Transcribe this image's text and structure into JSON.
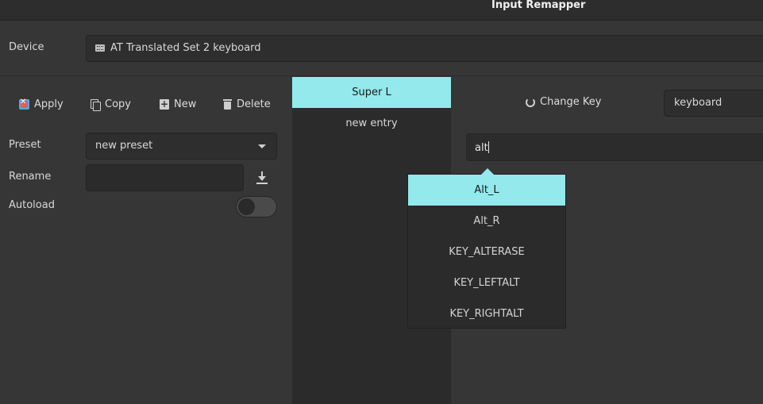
{
  "window": {
    "title": "Input Remapper"
  },
  "device": {
    "label": "Device",
    "selected": "AT Translated Set 2 keyboard",
    "icon": "keyboard-icon"
  },
  "toolbar": {
    "apply_label": "Apply",
    "copy_label": "Copy",
    "new_label": "New",
    "delete_label": "Delete"
  },
  "preset": {
    "label": "Preset",
    "selected": "new preset"
  },
  "rename": {
    "label": "Rename",
    "value": ""
  },
  "autoload": {
    "label": "Autoload",
    "enabled": false
  },
  "mappings": [
    {
      "label": "Super L",
      "selected": true
    },
    {
      "label": "new entry",
      "selected": false
    }
  ],
  "editor": {
    "change_key_label": "Change Key",
    "target_type": "keyboard",
    "input_value": "alt"
  },
  "suggestions": [
    "Alt_L",
    "Alt_R",
    "KEY_ALTERASE",
    "KEY_LEFTALT",
    "KEY_RIGHTALT"
  ],
  "colors": {
    "accent": "#93e9eb",
    "background": "#363636",
    "panel_dark": "#2b2b2b"
  }
}
